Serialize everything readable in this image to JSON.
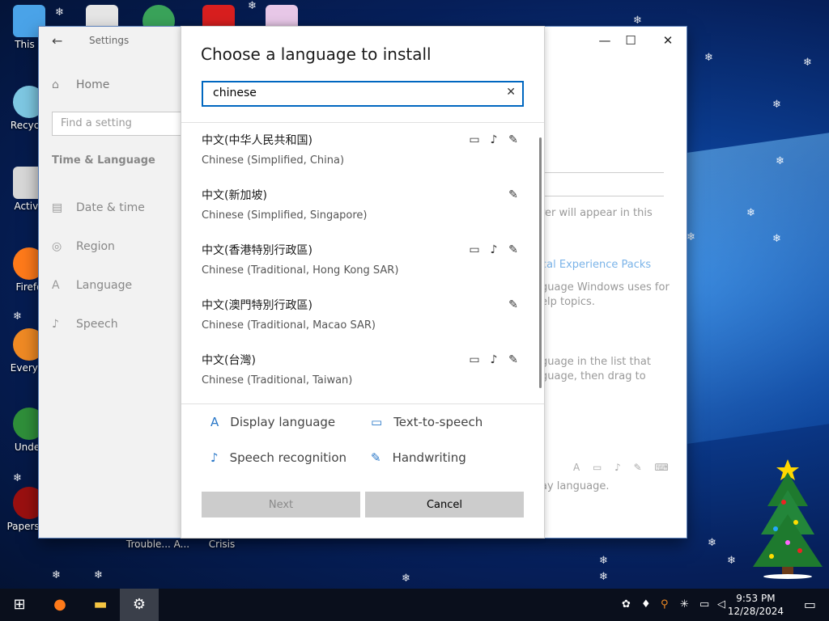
{
  "desktop": {
    "icons": [
      {
        "label": "This P",
        "color": "#4aa3e8"
      },
      {
        "label": "Recycle",
        "color": "#7ec8e3"
      },
      {
        "label": "Activa",
        "color": "#d8d8d8"
      },
      {
        "label": "Firefo",
        "color": "#ff7a1a"
      },
      {
        "label": "Everyth",
        "color": "#f08a24"
      },
      {
        "label": "Under",
        "color": "#2f8f3a"
      },
      {
        "label": "Papers, P",
        "color": "#9a1010"
      }
    ],
    "bottom_labels": [
      "Trouble... A...",
      "Crisis"
    ]
  },
  "settings_window": {
    "title": "Settings",
    "home_label": "Home",
    "find_placeholder": "Find a setting",
    "section": "Time & Language",
    "nav_items": [
      {
        "label": "Date & time",
        "icon": "calendar-icon"
      },
      {
        "label": "Region",
        "icon": "globe-icon"
      },
      {
        "label": "Language",
        "icon": "language-icon"
      },
      {
        "label": "Speech",
        "icon": "microphone-icon"
      }
    ],
    "background_text": {
      "line1": "rer will appear in this",
      "link": "cal Experience Packs",
      "line2a": "guage Windows uses for",
      "line2b": "elp topics.",
      "line3a": "guage in the list that",
      "line3b": "guage, then drag to",
      "line4": "ay language."
    }
  },
  "dialog": {
    "title": "Choose a language to install",
    "search_value": "chinese",
    "languages": [
      {
        "native": "中文(中华人民共和国)",
        "english": "Chinese (Simplified, China)",
        "features": [
          "display",
          "speech",
          "handwriting"
        ]
      },
      {
        "native": "中文(新加坡)",
        "english": "Chinese (Simplified, Singapore)",
        "features": [
          "handwriting"
        ]
      },
      {
        "native": "中文(香港特別行政區)",
        "english": "Chinese (Traditional, Hong Kong SAR)",
        "features": [
          "display",
          "speech",
          "handwriting"
        ]
      },
      {
        "native": "中文(澳門特別行政區)",
        "english": "Chinese (Traditional, Macao SAR)",
        "features": [
          "handwriting"
        ]
      },
      {
        "native": "中文(台灣)",
        "english": "Chinese (Traditional, Taiwan)",
        "features": [
          "display",
          "speech",
          "handwriting"
        ]
      }
    ],
    "legend": {
      "display_language": "Display language",
      "text_to_speech": "Text-to-speech",
      "speech_recognition": "Speech recognition",
      "handwriting": "Handwriting"
    },
    "next_label": "Next",
    "cancel_label": "Cancel"
  },
  "taskbar": {
    "time": "9:53 PM",
    "date": "12/28/2024"
  },
  "colors": {
    "accent": "#0067c0",
    "icon_blue": "#2a78c8",
    "button_gray": "#cccccc"
  }
}
